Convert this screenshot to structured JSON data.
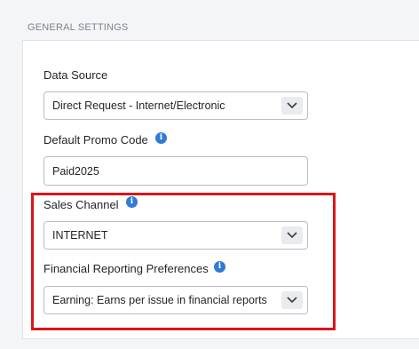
{
  "section": {
    "title": "GENERAL SETTINGS"
  },
  "fields": {
    "data_source": {
      "label": "Data Source",
      "value": "Direct Request - Internet/Electronic"
    },
    "promo_code": {
      "label": "Default Promo Code",
      "value": "Paid2025"
    },
    "sales_channel": {
      "label": "Sales Channel",
      "value": "INTERNET"
    },
    "financial_reporting": {
      "label": "Financial Reporting Preferences",
      "value": "Earning: Earns per issue in financial reports"
    }
  },
  "icons": {
    "info": "info-icon",
    "dropdown": "chevron-down-icon"
  },
  "colors": {
    "highlight": "#d8161b",
    "info": "#2f7bd6"
  }
}
